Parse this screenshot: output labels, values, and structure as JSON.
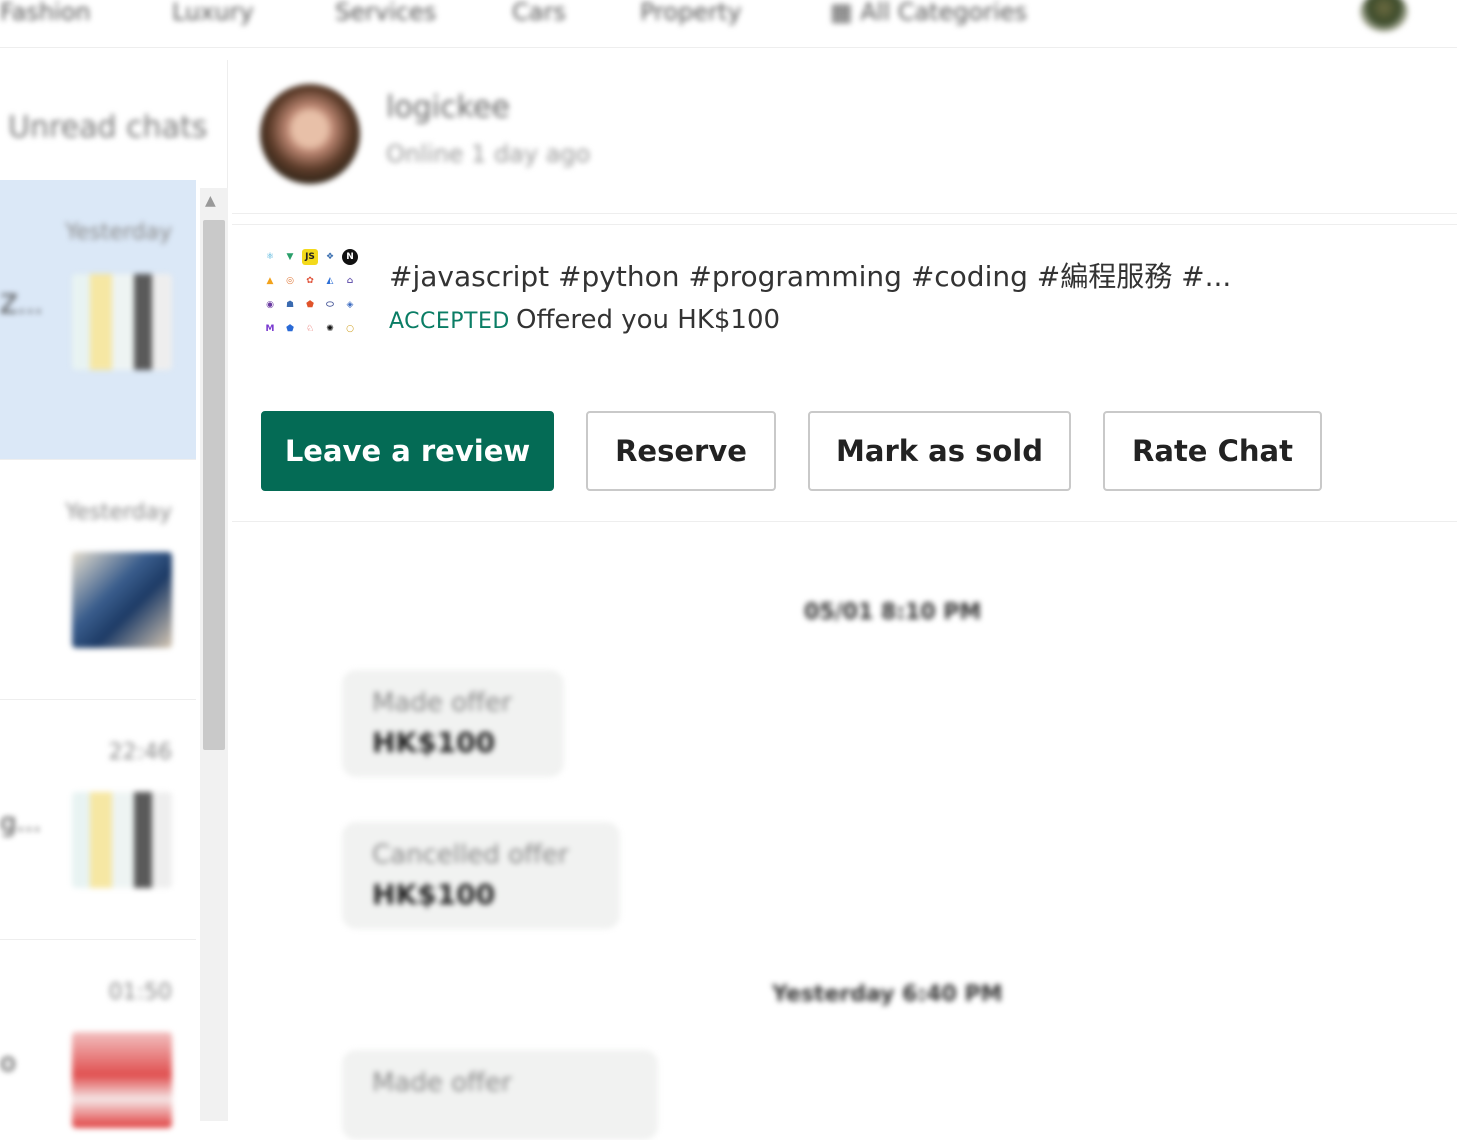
{
  "nav": {
    "items": [
      "Fashion",
      "Luxury",
      "Services",
      "Cars",
      "Property",
      "All Categories"
    ]
  },
  "sidebar": {
    "unread_label": "Unread chats",
    "chats": [
      {
        "time": "Yesterday",
        "snippet": "Z..."
      },
      {
        "time": "Yesterday",
        "snippet": ""
      },
      {
        "time": "22:46",
        "snippet": "g..."
      },
      {
        "time": "01:50",
        "snippet": "o"
      }
    ]
  },
  "chat": {
    "username": "logickee",
    "status": "Online 1 day ago",
    "listing": {
      "title": "#javascript #python #programming #coding #編程服務 #...",
      "status_badge": "ACCEPTED",
      "offer_text": "Offered you HK$100"
    },
    "actions": {
      "leave_review": "Leave a review",
      "reserve": "Reserve",
      "mark_sold": "Mark as sold",
      "rate_chat": "Rate Chat"
    },
    "messages": [
      {
        "type": "date",
        "text": "05/01  8:10 PM"
      },
      {
        "type": "bubble",
        "line1": "Made offer",
        "line2": "HK$100"
      },
      {
        "type": "bubble",
        "line1": "Cancelled offer",
        "line2": "HK$100"
      },
      {
        "type": "date",
        "text": "Yesterday  6:40 PM"
      },
      {
        "type": "bubble",
        "line1": "Made offer",
        "line2": ""
      }
    ]
  },
  "colors": {
    "primary_button": "#046b55",
    "accepted_badge": "#0a7d65",
    "active_chat_bg": "#dbe8f7"
  }
}
